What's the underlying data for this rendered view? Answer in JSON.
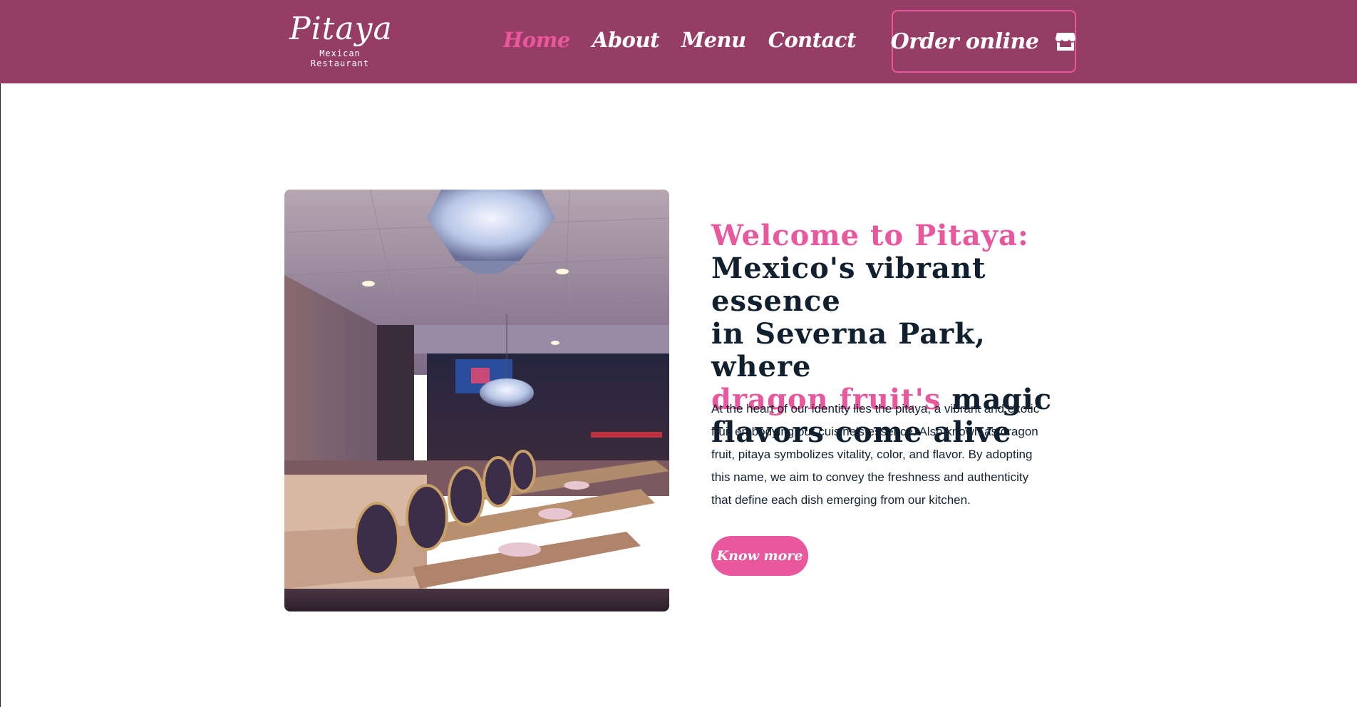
{
  "brand": {
    "name": "Pitaya",
    "tagline": "Mexican Restaurant"
  },
  "nav": {
    "items": [
      {
        "label": "Home",
        "active": true
      },
      {
        "label": "About",
        "active": false
      },
      {
        "label": "Menu",
        "active": false
      },
      {
        "label": "Contact",
        "active": false
      }
    ]
  },
  "order": {
    "label": "Order online",
    "icon": "store-icon"
  },
  "hero": {
    "image_icon": "restaurant-interior-photo",
    "heading_pink_1": "Welcome to Pitaya:",
    "heading_dark_1": "Mexico's vibrant essence",
    "heading_dark_2": "in Severna Park, where",
    "heading_pink_2": "dragon fruit's",
    "heading_dark_3": " magic",
    "heading_dark_4": "flavors come alive",
    "body": "At the heart of our identity lies the pitaya, a vibrant and exotic fruit embodying our cuisine's essence. Also known as dragon fruit, pitaya symbolizes vitality, color, and flavor. By adopting this name, we aim to convey the freshness and authenticity that define each dish emerging from our kitchen.",
    "button_label": "Know more"
  },
  "colors": {
    "header_bg": "#963d66",
    "accent_pink": "#e9579d",
    "text_dark": "#11202e",
    "page_bg": "#ffffff"
  }
}
